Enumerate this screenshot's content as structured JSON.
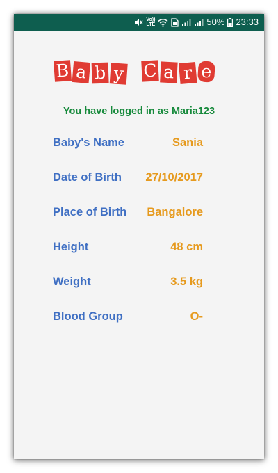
{
  "status_bar": {
    "battery_text": "50%",
    "time": "23:33",
    "volte_top": "Vo))",
    "volte_bottom": "LTE",
    "background": "#0e5e4f",
    "icons": [
      "mute-icon",
      "volte-icon",
      "wifi-icon",
      "sim-icon",
      "signal-icon",
      "signal-icon",
      "battery-icon"
    ]
  },
  "logo": {
    "word1": [
      "B",
      "a",
      "b",
      "y"
    ],
    "word2": [
      "C",
      "a",
      "r",
      "e"
    ],
    "tile_color": "#e03b33"
  },
  "login": {
    "message": "You have logged in as Maria123"
  },
  "details": [
    {
      "label": "Baby's Name",
      "value": "Sania"
    },
    {
      "label": "Date of Birth",
      "value": "27/10/2017"
    },
    {
      "label": "Place of Birth",
      "value": "Bangalore"
    },
    {
      "label": "Height",
      "value": "48 cm"
    },
    {
      "label": "Weight",
      "value": "3.5 kg"
    },
    {
      "label": "Blood Group",
      "value": "O-"
    }
  ],
  "colors": {
    "label": "#3f6fc3",
    "value": "#e69a1e",
    "message": "#178a3c",
    "background": "#f4f4f4"
  }
}
